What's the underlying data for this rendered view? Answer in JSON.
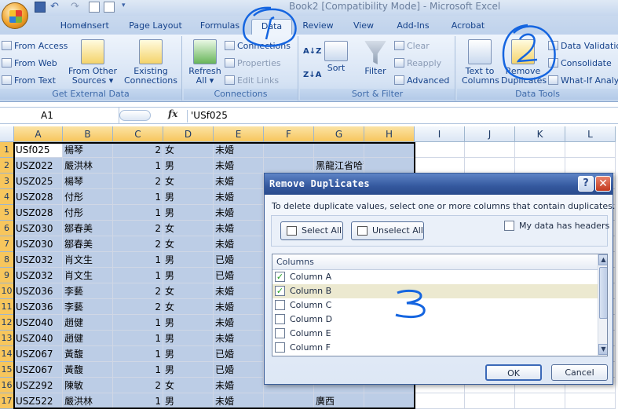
{
  "quick_access": {
    "more_label": "▾"
  },
  "title": "Book2  [Compatibility Mode]  -  Microsoft Excel",
  "tabs": [
    "Home",
    "Insert",
    "Page Layout",
    "Formulas",
    "Data",
    "Review",
    "View",
    "Add-Ins",
    "Acrobat"
  ],
  "active_tab": "Data",
  "ribbon": {
    "get_external_data": {
      "label": "Get External Data",
      "from_access": "From Access",
      "from_web": "From Web",
      "from_text": "From Text",
      "from_other_1": "From Other",
      "from_other_2": "Sources ▾",
      "existing_1": "Existing",
      "existing_2": "Connections"
    },
    "connections": {
      "label": "Connections",
      "refresh_1": "Refresh",
      "refresh_2": "All ▾",
      "connections": "Connections",
      "properties": "Properties",
      "edit_links": "Edit Links"
    },
    "sort_filter": {
      "label": "Sort & Filter",
      "sort": "Sort",
      "filter": "Filter",
      "clear": "Clear",
      "reapply": "Reapply",
      "advanced": "Advanced",
      "az": "A↓Z",
      "za": "Z↓A"
    },
    "data_tools": {
      "label": "Data Tools",
      "text_to_columns_1": "Text to",
      "text_to_columns_2": "Columns",
      "remove_dup_1": "Remove",
      "remove_dup_2": "Duplicates",
      "validation": "Data Validation ▾",
      "consolidate": "Consolidate",
      "whatif": "What-If Analysis ▾"
    }
  },
  "formula_bar": {
    "name_box": "A1",
    "fx": "fx",
    "content": "'USf025"
  },
  "columns": [
    "A",
    "B",
    "C",
    "D",
    "E",
    "F",
    "G",
    "H",
    "I",
    "J",
    "K",
    "L"
  ],
  "rows": [
    {
      "n": "1",
      "a": "USf025",
      "b": "楊琴",
      "c": "2",
      "d": "女",
      "e": "未婚",
      "g": ""
    },
    {
      "n": "2",
      "a": "USZ022",
      "b": "嚴洪林",
      "c": "1",
      "d": "男",
      "e": "未婚",
      "g": "黑龍江省哈爾"
    },
    {
      "n": "3",
      "a": "USZ025",
      "b": "楊琴",
      "c": "2",
      "d": "女",
      "e": "未婚",
      "g": ""
    },
    {
      "n": "4",
      "a": "USZ028",
      "b": "付彤",
      "c": "1",
      "d": "男",
      "e": "未婚",
      "g": ""
    },
    {
      "n": "5",
      "a": "USZ028",
      "b": "付彤",
      "c": "1",
      "d": "男",
      "e": "未婚",
      "g": ""
    },
    {
      "n": "6",
      "a": "USZ030",
      "b": "鄒春美",
      "c": "2",
      "d": "女",
      "e": "未婚",
      "g": ""
    },
    {
      "n": "7",
      "a": "USZ030",
      "b": "鄒春美",
      "c": "2",
      "d": "女",
      "e": "未婚",
      "g": ""
    },
    {
      "n": "8",
      "a": "USZ032",
      "b": "肖文生",
      "c": "1",
      "d": "男",
      "e": "已婚",
      "g": ""
    },
    {
      "n": "9",
      "a": "USZ032",
      "b": "肖文生",
      "c": "1",
      "d": "男",
      "e": "已婚",
      "g": ""
    },
    {
      "n": "10",
      "a": "USZ036",
      "b": "李藝",
      "c": "2",
      "d": "女",
      "e": "未婚",
      "g": ""
    },
    {
      "n": "11",
      "a": "USZ036",
      "b": "李藝",
      "c": "2",
      "d": "女",
      "e": "未婚",
      "g": ""
    },
    {
      "n": "12",
      "a": "USZ040",
      "b": "趙健",
      "c": "1",
      "d": "男",
      "e": "未婚",
      "g": ""
    },
    {
      "n": "13",
      "a": "USZ040",
      "b": "趙健",
      "c": "1",
      "d": "男",
      "e": "未婚",
      "g": ""
    },
    {
      "n": "14",
      "a": "USZ067",
      "b": "黃馥",
      "c": "1",
      "d": "男",
      "e": "已婚",
      "g": ""
    },
    {
      "n": "15",
      "a": "USZ067",
      "b": "黃馥",
      "c": "1",
      "d": "男",
      "e": "已婚",
      "g": ""
    },
    {
      "n": "16",
      "a": "USZ292",
      "b": "陳敏",
      "c": "2",
      "d": "女",
      "e": "未婚",
      "g": ""
    },
    {
      "n": "17",
      "a": "USZ522",
      "b": "嚴洪林",
      "c": "1",
      "d": "男",
      "e": "未婚",
      "g": "廣西"
    }
  ],
  "dialog": {
    "title": "Remove Duplicates",
    "help": "?",
    "close": "✕",
    "instructions": "To delete duplicate values, select one or more columns that contain duplicates.",
    "select_all": "Select All",
    "unselect_all": "Unselect All",
    "has_headers": "My data has headers",
    "list_header": "Columns",
    "items": [
      {
        "label": "Column A",
        "checked": true
      },
      {
        "label": "Column B",
        "checked": true
      },
      {
        "label": "Column C",
        "checked": false
      },
      {
        "label": "Column D",
        "checked": false
      },
      {
        "label": "Column E",
        "checked": false
      },
      {
        "label": "Column F",
        "checked": false
      }
    ],
    "check_mark": "✓",
    "scroll_up": "▲",
    "scroll_down": "▼",
    "ok": "OK",
    "cancel": "Cancel"
  },
  "colors": {
    "accent": "#15428b",
    "annotation": "#1565e0",
    "selection": "#bccde6"
  }
}
